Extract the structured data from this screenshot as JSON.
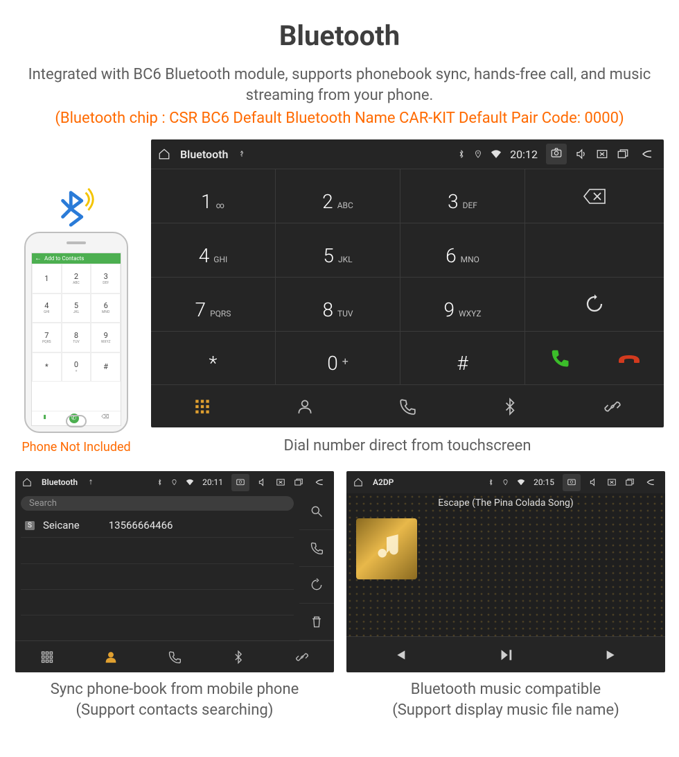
{
  "header": {
    "title": "Bluetooth",
    "description": "Integrated with BC6 Bluetooth module, supports phonebook sync, hands-free call, and music streaming from your phone.",
    "specs": "(Bluetooth chip : CSR BC6     Default Bluetooth Name CAR-KIT     Default Pair Code: 0000)"
  },
  "phone": {
    "header_label": "Add to Contacts",
    "caption": "Phone Not Included",
    "keys": [
      {
        "d": "1",
        "s": ""
      },
      {
        "d": "2",
        "s": "ABC"
      },
      {
        "d": "3",
        "s": "DEF"
      },
      {
        "d": "4",
        "s": "GHI"
      },
      {
        "d": "5",
        "s": "JKL"
      },
      {
        "d": "6",
        "s": "MNO"
      },
      {
        "d": "7",
        "s": "PQRS"
      },
      {
        "d": "8",
        "s": "TUV"
      },
      {
        "d": "9",
        "s": "WXYZ"
      },
      {
        "d": "*",
        "s": ""
      },
      {
        "d": "0",
        "s": "+"
      },
      {
        "d": "#",
        "s": ""
      }
    ]
  },
  "dialer": {
    "status": {
      "title": "Bluetooth",
      "time": "20:12"
    },
    "keys": [
      {
        "d": "1",
        "s": "∞"
      },
      {
        "d": "2",
        "s": "ABC"
      },
      {
        "d": "3",
        "s": "DEF"
      },
      {
        "d": "4",
        "s": "GHI"
      },
      {
        "d": "5",
        "s": "JKL"
      },
      {
        "d": "6",
        "s": "MNO"
      },
      {
        "d": "7",
        "s": "PQRS"
      },
      {
        "d": "8",
        "s": "TUV"
      },
      {
        "d": "9",
        "s": "WXYZ"
      },
      {
        "d": "*",
        "s": ""
      },
      {
        "d": "0",
        "s": "+"
      },
      {
        "d": "#",
        "s": ""
      }
    ],
    "caption": "Dial number direct from touchscreen"
  },
  "contacts": {
    "status": {
      "title": "Bluetooth",
      "time": "20:11"
    },
    "search_placeholder": "Search",
    "rows": [
      {
        "tag": "S",
        "name": "Seicane",
        "number": "13566664466"
      }
    ],
    "caption_line1": "Sync phone-book from mobile phone",
    "caption_line2": "(Support contacts searching)"
  },
  "music": {
    "status": {
      "title": "A2DP",
      "time": "20:15"
    },
    "song": "Escape (The Pina Colada Song)",
    "caption_line1": "Bluetooth music compatible",
    "caption_line2": "(Support display music file name)"
  }
}
